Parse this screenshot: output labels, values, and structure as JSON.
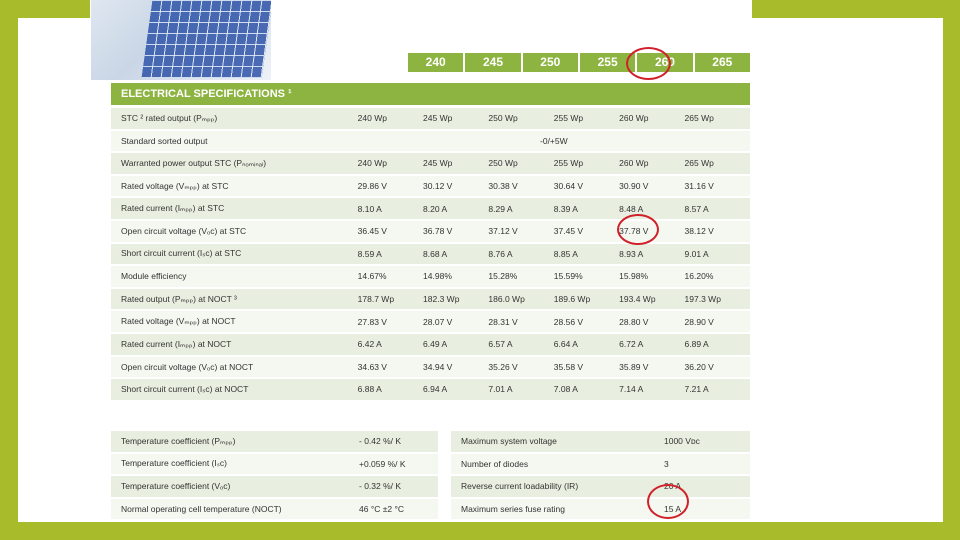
{
  "header": {
    "columns": [
      "240",
      "245",
      "250",
      "255",
      "260",
      "265"
    ],
    "language": "EN"
  },
  "section_title": "ELECTRICAL SPECIFICATIONS ¹",
  "electrical_rows": [
    {
      "label": "STC ² rated output (Pₘₚₚ)",
      "values": [
        "240 Wp",
        "245 Wp",
        "250 Wp",
        "255 Wp",
        "260 Wp",
        "265 Wp"
      ]
    },
    {
      "label": "Standard sorted output",
      "merged": "-0/+5W"
    },
    {
      "label": "Warranted power output STC (Pₙₒₘᵢₙₐₗ)",
      "values": [
        "240 Wp",
        "245 Wp",
        "250 Wp",
        "255 Wp",
        "260 Wp",
        "265 Wp"
      ]
    },
    {
      "label": "Rated voltage (Vₘₚₚ) at STC",
      "values": [
        "29.86 V",
        "30.12 V",
        "30.38 V",
        "30.64 V",
        "30.90 V",
        "31.16 V"
      ]
    },
    {
      "label": "Rated current (Iₘₚₚ) at STC",
      "values": [
        "8.10 A",
        "8.20 A",
        "8.29 A",
        "8.39 A",
        "8.48 A",
        "8.57 A"
      ]
    },
    {
      "label": "Open circuit voltage (Vₒc) at STC",
      "values": [
        "36.45 V",
        "36.78 V",
        "37.12 V",
        "37.45 V",
        "37.78 V",
        "38.12 V"
      ]
    },
    {
      "label": "Short circuit current (Iₛc) at STC",
      "values": [
        "8.59 A",
        "8.68 A",
        "8.76 A",
        "8.85 A",
        "8.93 A",
        "9.01 A"
      ]
    },
    {
      "label": "Module efficiency",
      "values": [
        "14.67%",
        "14.98%",
        "15.28%",
        "15.59%",
        "15.98%",
        "16.20%"
      ]
    },
    {
      "label": "Rated output (Pₘₚₚ) at NOCT ³",
      "values": [
        "178.7 Wp",
        "182.3 Wp",
        "186.0 Wp",
        "189.6 Wp",
        "193.4 Wp",
        "197.3 Wp"
      ]
    },
    {
      "label": "Rated voltage (Vₘₚₚ) at NOCT",
      "values": [
        "27.83 V",
        "28.07 V",
        "28.31 V",
        "28.56 V",
        "28.80 V",
        "28.90 V"
      ]
    },
    {
      "label": "Rated current (Iₘₚₚ) at NOCT",
      "values": [
        "6.42 A",
        "6.49 A",
        "6.57 A",
        "6.64 A",
        "6.72 A",
        "6.89 A"
      ]
    },
    {
      "label": "Open circuit voltage (Vₒc) at NOCT",
      "values": [
        "34.63 V",
        "34.94 V",
        "35.26 V",
        "35.58 V",
        "35.89 V",
        "36.20 V"
      ]
    },
    {
      "label": "Short circuit current (Iₛc) at NOCT",
      "values": [
        "6.88 A",
        "6.94 A",
        "7.01 A",
        "7.08 A",
        "7.14 A",
        "7.21 A"
      ]
    }
  ],
  "temperature_rows": [
    {
      "label": "Temperature coefficient (Pₘₚₚ)",
      "value": "- 0.42 %/ K"
    },
    {
      "label": "Temperature coefficient (Iₛc)",
      "value": "+0.059 %/ K"
    },
    {
      "label": "Temperature coefficient (Vₒc)",
      "value": "- 0.32 %/ K"
    },
    {
      "label": "Normal operating cell temperature (NOCT)",
      "value": "46 °C ±2 °C"
    }
  ],
  "system_rows": [
    {
      "label": "Maximum system voltage",
      "value": "1000 Vᴅc"
    },
    {
      "label": "Number of diodes",
      "value": "3"
    },
    {
      "label": "Reverse current loadability (IR)",
      "value": "20 A"
    },
    {
      "label": "Maximum series fuse rating",
      "value": "15 A"
    }
  ],
  "colors": {
    "slide_border": "#a8bb2a",
    "table_green": "#8db340",
    "row_light": "#e9efe0",
    "highlight_circle": "#d0202a"
  }
}
